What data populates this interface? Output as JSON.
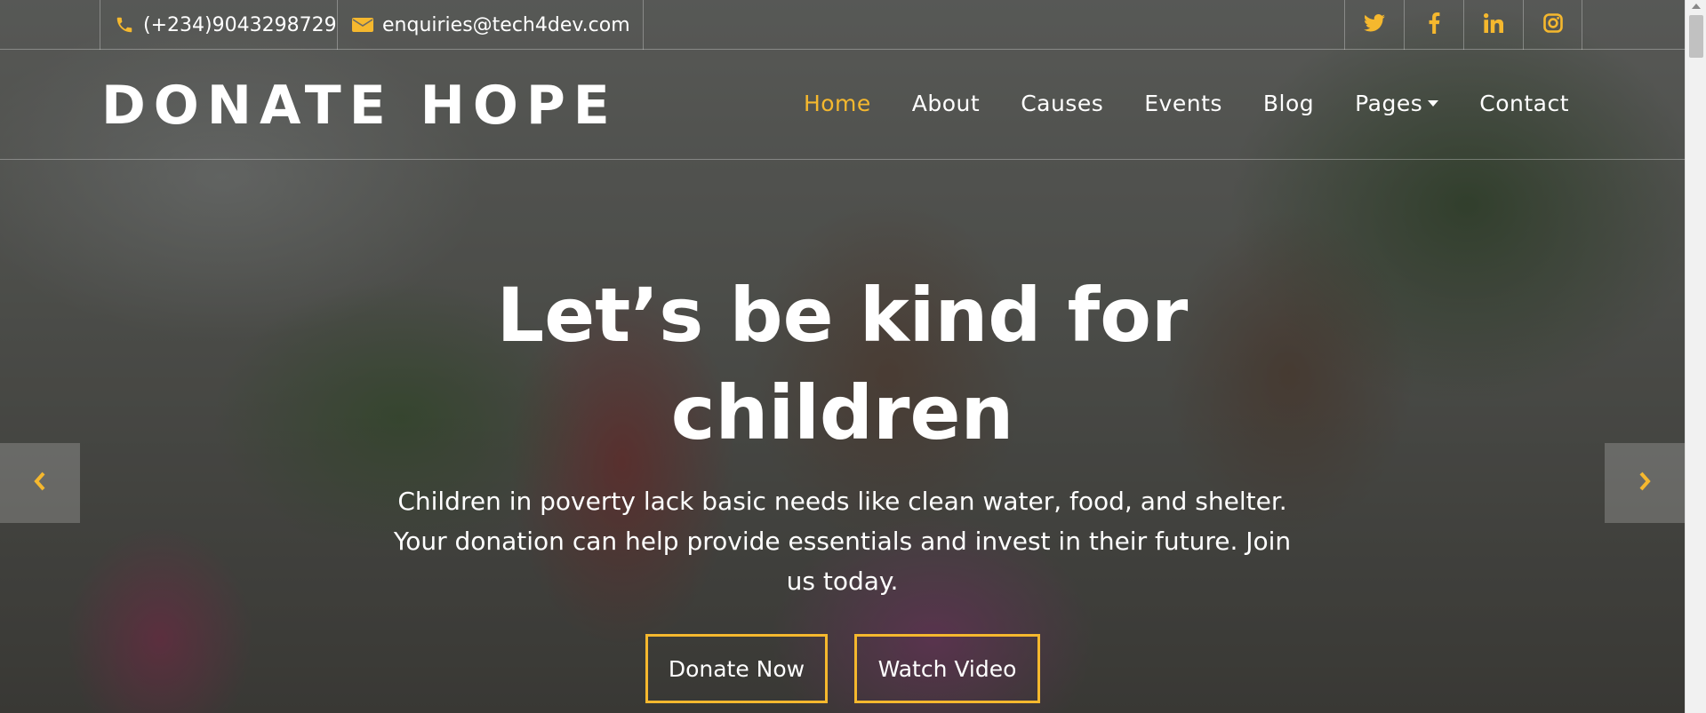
{
  "topbar": {
    "phone": "(+234)9043298729",
    "email": "enquiries@tech4dev.com",
    "social": [
      {
        "icon": "twitter-icon"
      },
      {
        "icon": "facebook-icon"
      },
      {
        "icon": "linkedin-icon"
      },
      {
        "icon": "instagram-icon"
      }
    ]
  },
  "navbar": {
    "brand": "DONATE HOPE",
    "items": [
      {
        "label": "Home",
        "active": true
      },
      {
        "label": "About"
      },
      {
        "label": "Causes"
      },
      {
        "label": "Events"
      },
      {
        "label": "Blog"
      },
      {
        "label": "Pages",
        "dropdown": true
      },
      {
        "label": "Contact"
      }
    ]
  },
  "hero": {
    "title_line1": "Let’s be kind for",
    "title_line2": "children",
    "text": "Children in poverty lack basic needs like clean water, food, and shelter. Your donation can help provide essentials and invest in their future. Join us today.",
    "donate_label": "Donate Now",
    "video_label": "Watch Video"
  },
  "colors": {
    "accent": "#f5b82e",
    "text": "#ffffff"
  }
}
